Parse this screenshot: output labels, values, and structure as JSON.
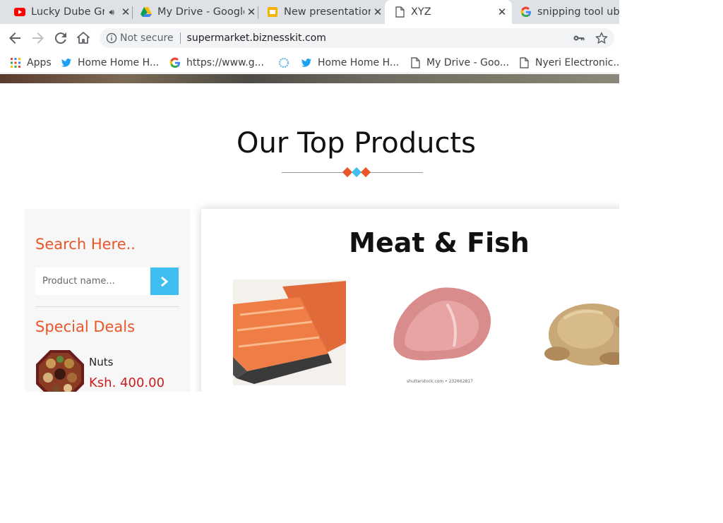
{
  "browser": {
    "tabs": [
      {
        "title": "Lucky Dube Greatest Hits",
        "icon": "youtube-icon",
        "audio": true
      },
      {
        "title": "My Drive - Google Drive",
        "icon": "google-drive-icon"
      },
      {
        "title": "New presentation - Google Slides",
        "icon": "google-slides-icon"
      },
      {
        "title": "XYZ",
        "icon": "page-icon",
        "active": true
      },
      {
        "title": "snipping tool ubuntu",
        "icon": "google-icon"
      }
    ],
    "omnibox": {
      "security_label": "Not secure",
      "url": "supermarket.biznesskit.com"
    },
    "bookmarks": [
      {
        "label": "Apps",
        "icon": "apps-grid-icon"
      },
      {
        "label": "Home Home H...",
        "icon": "twitter-icon"
      },
      {
        "label": "https://www.g...",
        "icon": "google-icon"
      },
      {
        "label": "",
        "icon": "ring-icon"
      },
      {
        "label": "Home Home H...",
        "icon": "twitter-icon"
      },
      {
        "label": "My Drive - Goo...",
        "icon": "page-icon"
      },
      {
        "label": "Nyeri Electronic...",
        "icon": "page-icon"
      }
    ]
  },
  "page": {
    "section_title": "Our Top Products",
    "sidebar": {
      "search_heading": "Search Here..",
      "search_placeholder": "Product name...",
      "deals_heading": "Special Deals",
      "deal": {
        "name": "Nuts",
        "price": "Ksh. 400.00"
      }
    },
    "category": {
      "title": "Meat & Fish",
      "products": [
        {
          "image": "salmon-fillet-image"
        },
        {
          "image": "raw-meat-image",
          "watermark": "shutterstock.com • 232662817"
        },
        {
          "image": "raw-chicken-image"
        }
      ]
    }
  },
  "colors": {
    "accent_orange": "#e8562a",
    "accent_blue": "#3ebff0",
    "price_red": "#c81e1e"
  }
}
